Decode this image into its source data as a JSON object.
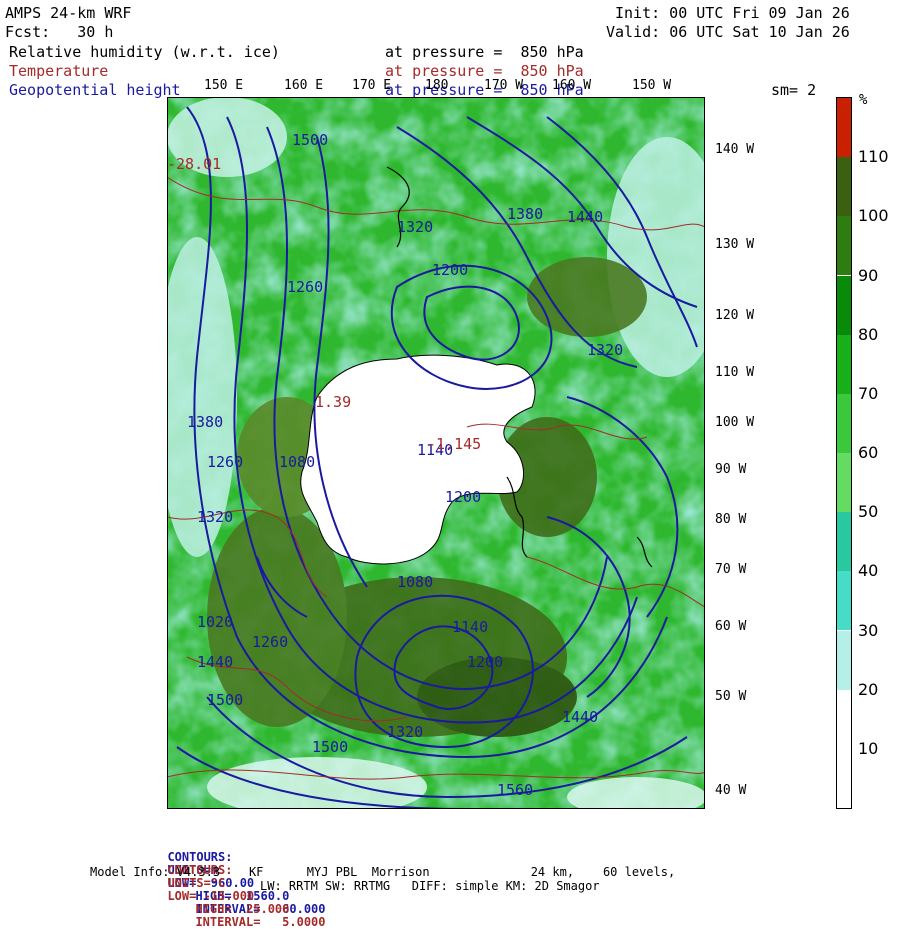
{
  "header": {
    "model": "AMPS 24-km WRF",
    "forecast": "Fcst:   30 h",
    "init": "Init: 00 UTC Fri 09 Jan 26",
    "valid": "Valid: 06 UTC Sat 10 Jan 26",
    "fields": [
      {
        "name": "Relative humidity (w.r.t. ice)",
        "level": "at pressure =  850 hPa",
        "color": "#000000"
      },
      {
        "name": "Temperature",
        "level": "at pressure =  850 hPa",
        "color": "#a52a2a"
      },
      {
        "name": "Geopotential height",
        "level": "at pressure =  850 hPa",
        "color": "#1a1aa0"
      }
    ],
    "smoothing": "sm= 2"
  },
  "longitude_labels_top": [
    "150 E",
    "160 E",
    "170 E",
    "180",
    "170 W",
    "160 W",
    "150 W"
  ],
  "longitude_labels_right": [
    "140 W",
    "130 W",
    "120 W",
    "110 W",
    "100 W",
    "90 W",
    "80 W",
    "70 W",
    "60 W",
    "50 W",
    "40 W"
  ],
  "contour_labels": {
    "height": [
      "1500",
      "1380",
      "1440",
      "1320",
      "1260",
      "1200",
      "1140",
      "1080",
      "1020",
      "1080",
      "1200",
      "1260",
      "1320",
      "1380",
      "1440",
      "1500",
      "1560",
      "1500",
      "1440",
      "1320",
      "1200",
      "1260",
      "1140",
      "1320"
    ],
    "temperature": [
      "-28.01",
      "1.39",
      "-1.145"
    ]
  },
  "colorbar": {
    "unit": "%",
    "labels": [
      "110",
      "100",
      "90",
      "80",
      "70",
      "60",
      "50",
      "40",
      "30",
      "20",
      "10"
    ],
    "colors": [
      "#c82000",
      "#3a6010",
      "#2e7d10",
      "#0a8a0a",
      "#18b018",
      "#3cc83c",
      "#64dc64",
      "#28c8a0",
      "#46dcc8",
      "#b4f0e8",
      "#ffffff",
      "#ffffff"
    ]
  },
  "footer": {
    "line1": {
      "label": "CONTOURS:",
      "units": "UNITS=m",
      "low": "LOW=  960.00",
      "high": "HIGH=  1560.0",
      "interval": "INTERVAL=   60.000"
    },
    "line2": {
      "label": "CONTOURS:",
      "units": "UNITS=°C",
      "low": "LOW= -15.000",
      "high": "HIGH=  25.000",
      "interval": "INTERVAL=   5.0000"
    },
    "model_info": "Model Info: V4.3.3    KF      MYJ PBL  Morrison              24 km,    60 levels,",
    "model_info2": "LW: RRTM SW: RRTMG   DIFF: simple KM: 2D Smagor"
  },
  "colors": {
    "height_contour": "#1a1aa0",
    "temperature_contour": "#a52a2a",
    "continent": "#ffffff"
  }
}
